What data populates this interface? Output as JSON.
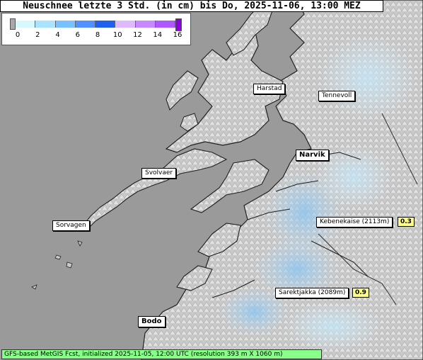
{
  "title": "Neuschnee letzte 3 Std. (in cm) bis Do, 2025-11-06, 13:00 MEZ",
  "legend": {
    "ticks": [
      "0",
      "2",
      "4",
      "6",
      "8",
      "10",
      "12",
      "14",
      "16"
    ],
    "colors": [
      "#d8f8ff",
      "#a8e4ff",
      "#78c0ff",
      "#5090ff",
      "#2060f0",
      "#e0b8ff",
      "#c888ff",
      "#b058ff"
    ]
  },
  "places": {
    "harstad": "Harstad",
    "tennevoll": "Tennevoll",
    "narvik": "Narvik",
    "svolvaer": "Svolvaer",
    "sorvagen": "Sorvagen",
    "kebnekaise": "Kebenekaise (2113m)",
    "sarektjakka": "Sarektjakka (2089m)",
    "bodo": "Bodo"
  },
  "values": {
    "kebnekaise": "0.3",
    "sarektjakka": "0.9"
  },
  "footer": "GFS-based MetGIS Fcst, initialized 2025-11-05, 12:00 UTC  (resolution 393 m X 1060 m)",
  "colors": {
    "sea": "#9a9a9a",
    "land": "#c8c8c8",
    "snow_light": "#c8e4f4",
    "snow_mid": "#a8d0f0",
    "coast": "#202020"
  }
}
